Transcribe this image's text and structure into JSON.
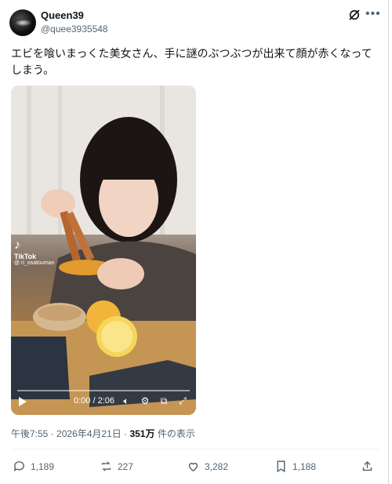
{
  "user": {
    "name": "Queen39",
    "handle": "@quee3935548"
  },
  "tweet": {
    "line1": "エビを喰いまっくた美女さん、手に謎のぶつぶつが出来て顔が赤くなって",
    "line2": "しまう。"
  },
  "video": {
    "watermark_brand": "TikTok",
    "watermark_user": "@ ri_osatouman",
    "time": "0:00 / 2:06"
  },
  "meta": {
    "time": "午後7:55",
    "date": "2026年4月21日",
    "views_count": "351万",
    "views_label": "件の表示"
  },
  "actions": {
    "replies": "1,189",
    "reposts": "227",
    "likes": "3,282",
    "bookmarks": "1,188"
  }
}
